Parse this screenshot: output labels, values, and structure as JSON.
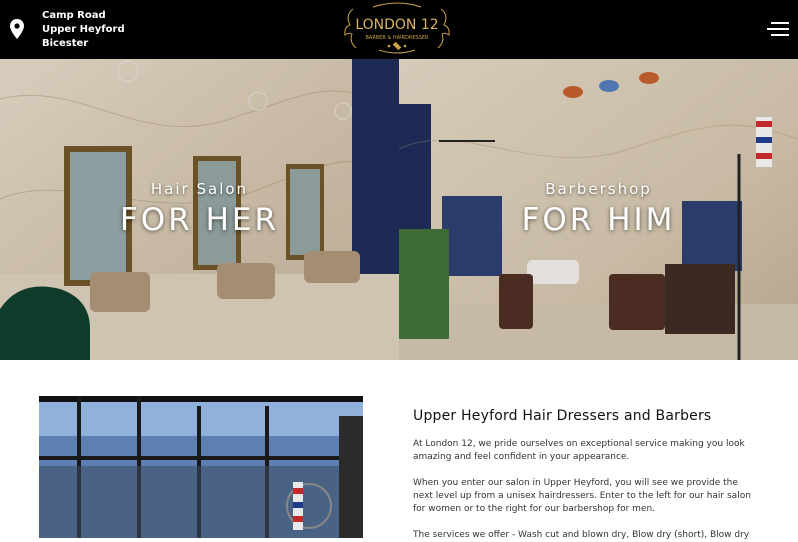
{
  "header": {
    "address_line1": "Camp Road",
    "address_line2": "Upper Heyford",
    "address_line3": "Bicester",
    "logo_name": "LONDON 12",
    "logo_tagline": "BARBER & HAIRDRESSER",
    "logo_icon": "scissors-icon",
    "menu_icon": "hamburger-menu-icon",
    "pin_icon": "location-pin-icon"
  },
  "hero": {
    "left": {
      "subtitle": "Hair Salon",
      "title": "FOR HER"
    },
    "right": {
      "subtitle": "Barbershop",
      "title": "FOR HIM"
    }
  },
  "about": {
    "heading": "Upper Heyford Hair Dressers and Barbers",
    "paragraph1": "At London 12, we pride ourselves on exceptional service making you look amazing and feel confident in your appearance.",
    "paragraph2": "When you enter our salon in Upper Heyford, you will see we provide the next level up from a unisex hairdressers. Enter to the left for our hair salon for women or to the right for our barbershop for men.",
    "paragraph3": "The services we offer - Wash cut and blown dry, Blow dry (short), Blow dry"
  },
  "colors": {
    "header_bg": "#000000",
    "gold": "#c9a24a",
    "navy": "#1c2b55"
  }
}
